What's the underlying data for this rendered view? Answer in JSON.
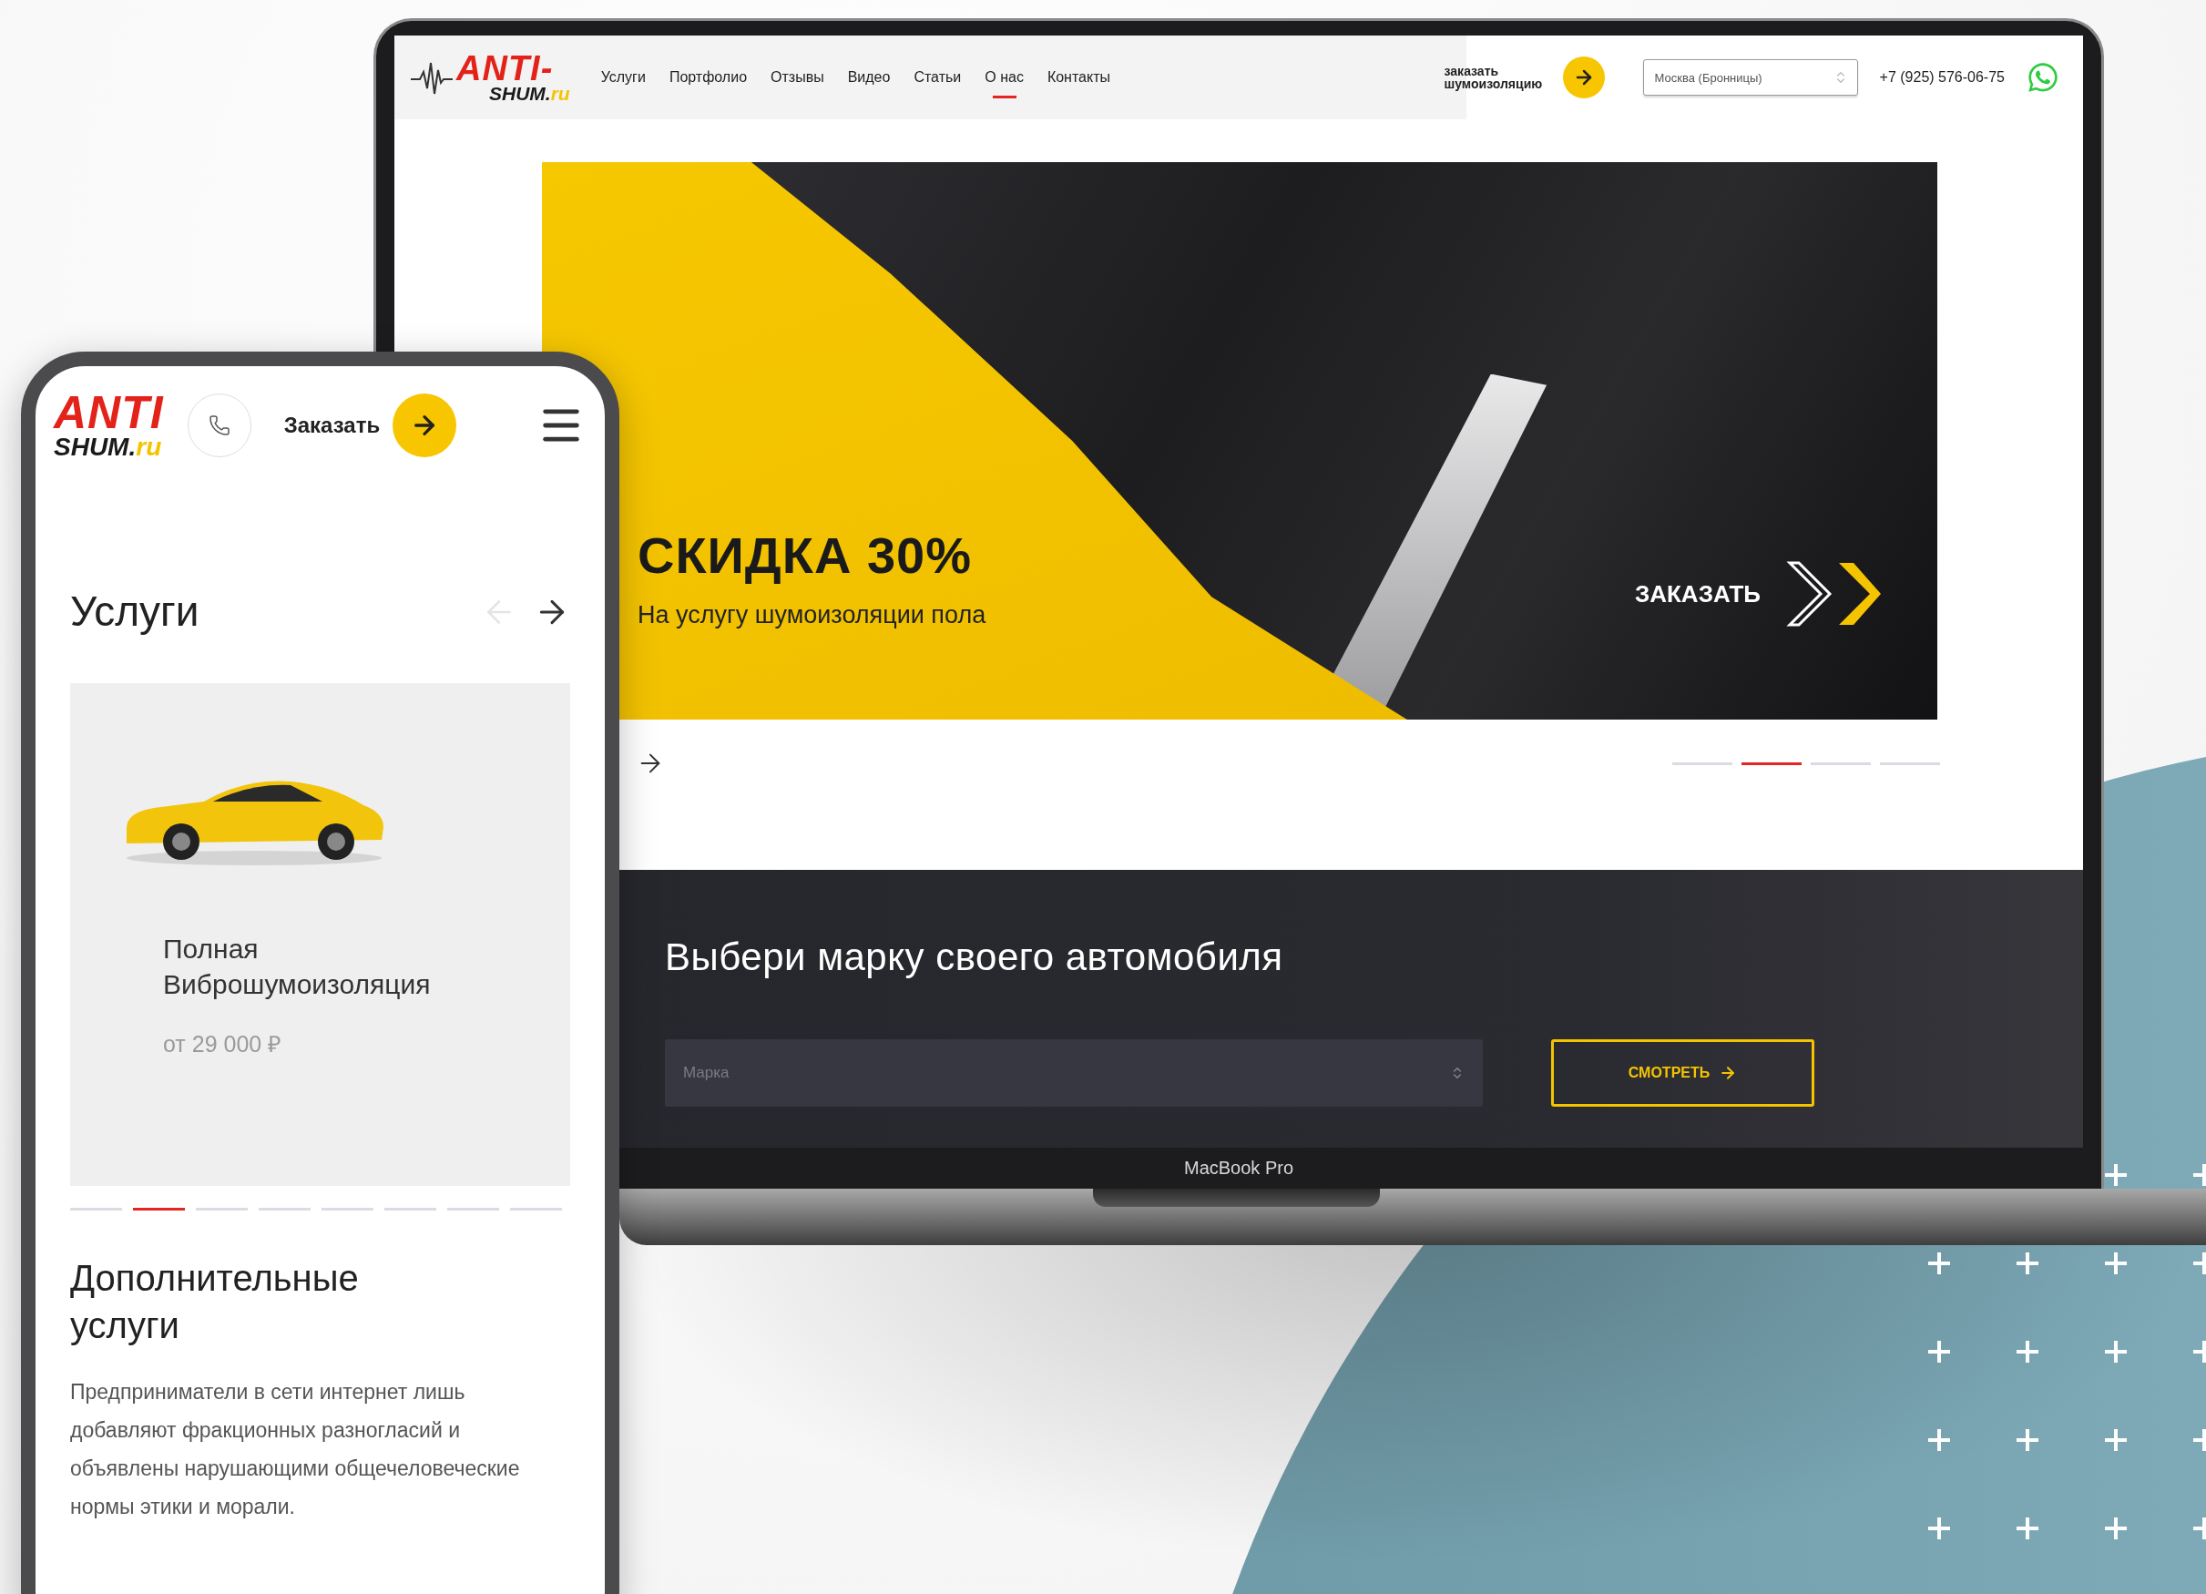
{
  "laptop": {
    "site": {
      "logo": {
        "top": "ANTI-",
        "bottom": "SHUM.",
        "domain": "ru"
      },
      "nav": [
        {
          "label": "Услуги",
          "selected": false
        },
        {
          "label": "Портфолио",
          "selected": false
        },
        {
          "label": "Отзывы",
          "selected": false
        },
        {
          "label": "Видео",
          "selected": false
        },
        {
          "label": "Статьи",
          "selected": false
        },
        {
          "label": "О нас",
          "selected": true
        },
        {
          "label": "Контакты",
          "selected": false
        }
      ],
      "order_link": "заказать шумоизоляцию",
      "city_select": {
        "value": "Москва (Бронницы)"
      },
      "phone": "+7 (925) 576-06-75",
      "hero": {
        "title": "СКИДКА 30%",
        "subtitle": "На услугу шумоизоляции пола",
        "cta": "ЗАКАЗАТЬ",
        "slides": [
          {
            "selected": false
          },
          {
            "selected": true
          },
          {
            "selected": false
          },
          {
            "selected": false
          }
        ]
      },
      "brand_picker": {
        "heading": "Выбери марку своего автомобиля",
        "select": {
          "placeholder": "Марка"
        },
        "button": "СМОТРЕТЬ"
      }
    },
    "label": "MacBook Pro"
  },
  "phone": {
    "logo": {
      "top": "ANTI",
      "bottom": "SHUM.",
      "domain": "ru"
    },
    "order_button": "Заказать",
    "services": {
      "heading": "Услуги",
      "card": {
        "title": "Полная Виброшумоизоляция",
        "price": "от 29 000 ₽"
      },
      "slides": [
        {
          "selected": false
        },
        {
          "selected": true
        },
        {
          "selected": false
        },
        {
          "selected": false
        },
        {
          "selected": false
        },
        {
          "selected": false
        },
        {
          "selected": false
        },
        {
          "selected": false
        }
      ]
    },
    "extra": {
      "heading": "Дополнительные услуги",
      "text": "Предприниматели в сети интернет лишь добавляют фракционных разногласий и объявлены нарушающими общечеловеческие нормы этики и морали."
    }
  }
}
